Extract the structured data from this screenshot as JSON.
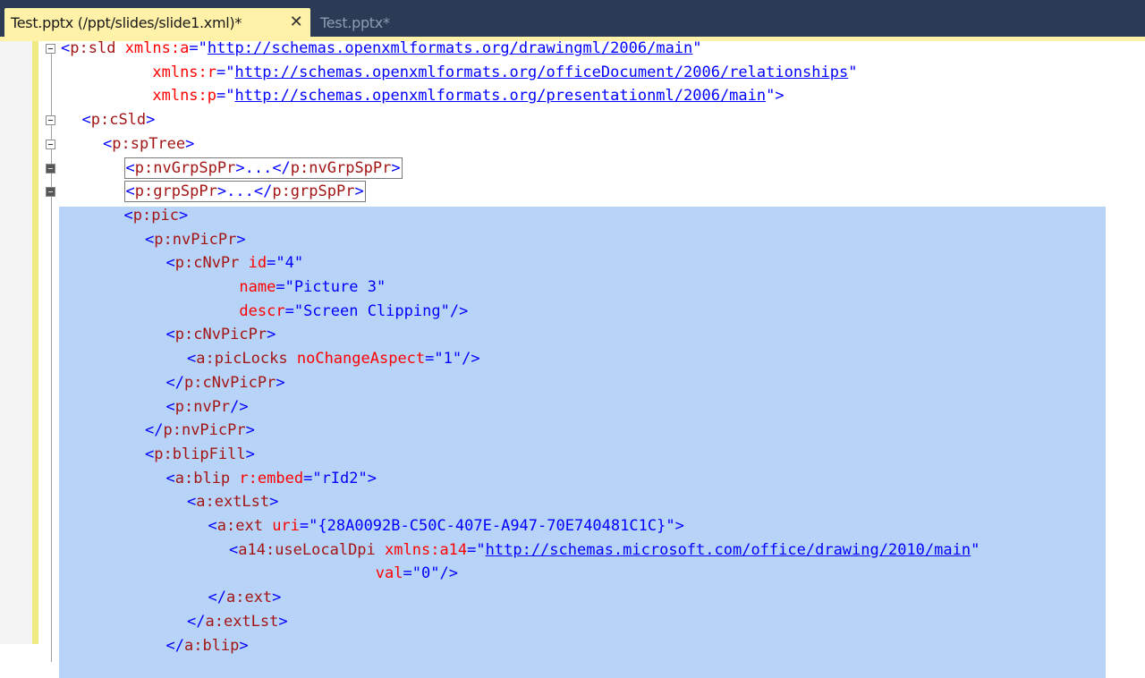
{
  "tabs": [
    {
      "label": "Test.pptx (/ppt/slides/slide1.xml)*",
      "active": true
    },
    {
      "label": "Test.pptx*",
      "active": false
    }
  ],
  "close_glyph": "✕",
  "collapsed_text": "...",
  "lines": [
    {
      "indent": 0,
      "parts": [
        [
          "sym",
          "<"
        ],
        [
          "tag",
          "p:sld"
        ],
        [
          "sym",
          " "
        ],
        [
          "attr",
          "xmlns:a"
        ],
        [
          "sym",
          "=\""
        ],
        [
          "link",
          "http://schemas.openxmlformats.org/drawingml/2006/main"
        ],
        [
          "sym",
          "\""
        ]
      ]
    },
    {
      "indent": 0,
      "parts": [
        [
          "sym",
          "          "
        ],
        [
          "attr",
          "xmlns:r"
        ],
        [
          "sym",
          "=\""
        ],
        [
          "link",
          "http://schemas.openxmlformats.org/officeDocument/2006/relationships"
        ],
        [
          "sym",
          "\""
        ]
      ]
    },
    {
      "indent": 0,
      "parts": [
        [
          "sym",
          "          "
        ],
        [
          "attr",
          "xmlns:p"
        ],
        [
          "sym",
          "=\""
        ],
        [
          "link",
          "http://schemas.openxmlformats.org/presentationml/2006/main"
        ],
        [
          "sym",
          "\">"
        ]
      ]
    },
    {
      "indent": 1,
      "parts": [
        [
          "sym",
          "<"
        ],
        [
          "tag",
          "p:cSld"
        ],
        [
          "sym",
          ">"
        ]
      ]
    },
    {
      "indent": 2,
      "parts": [
        [
          "sym",
          "<"
        ],
        [
          "tag",
          "p:spTree"
        ],
        [
          "sym",
          ">"
        ]
      ]
    },
    {
      "indent": 3,
      "collapsed": true,
      "parts": [
        [
          "sym",
          "<"
        ],
        [
          "tag",
          "p:nvGrpSpPr"
        ],
        [
          "sym",
          ">"
        ],
        [
          "col",
          ""
        ],
        [
          "sym",
          "</"
        ],
        [
          "tag",
          "p:nvGrpSpPr"
        ],
        [
          "sym",
          ">"
        ]
      ]
    },
    {
      "indent": 3,
      "collapsed": true,
      "parts": [
        [
          "sym",
          "<"
        ],
        [
          "tag",
          "p:grpSpPr"
        ],
        [
          "sym",
          ">"
        ],
        [
          "col",
          ""
        ],
        [
          "sym",
          "</"
        ],
        [
          "tag",
          "p:grpSpPr"
        ],
        [
          "sym",
          ">"
        ]
      ]
    },
    {
      "indent": 3,
      "sel": true,
      "parts": [
        [
          "sym",
          "<"
        ],
        [
          "tag",
          "p:pic"
        ],
        [
          "sym",
          ">"
        ]
      ]
    },
    {
      "indent": 4,
      "sel": true,
      "parts": [
        [
          "sym",
          "<"
        ],
        [
          "tag",
          "p:nvPicPr"
        ],
        [
          "sym",
          ">"
        ]
      ]
    },
    {
      "indent": 5,
      "sel": true,
      "parts": [
        [
          "sym",
          "<"
        ],
        [
          "tag",
          "p:cNvPr"
        ],
        [
          "sym",
          " "
        ],
        [
          "attr",
          "id"
        ],
        [
          "sym",
          "=\""
        ],
        [
          "val",
          "4"
        ],
        [
          "sym",
          "\""
        ]
      ]
    },
    {
      "indent": 5,
      "sel": true,
      "parts": [
        [
          "sym",
          "        "
        ],
        [
          "attr",
          "name"
        ],
        [
          "sym",
          "=\""
        ],
        [
          "val",
          "Picture 3"
        ],
        [
          "sym",
          "\""
        ]
      ]
    },
    {
      "indent": 5,
      "sel": true,
      "parts": [
        [
          "sym",
          "        "
        ],
        [
          "attr",
          "descr"
        ],
        [
          "sym",
          "=\""
        ],
        [
          "val",
          "Screen Clipping"
        ],
        [
          "sym",
          "\"/>"
        ]
      ]
    },
    {
      "indent": 5,
      "sel": true,
      "parts": [
        [
          "sym",
          "<"
        ],
        [
          "tag",
          "p:cNvPicPr"
        ],
        [
          "sym",
          ">"
        ]
      ]
    },
    {
      "indent": 6,
      "sel": true,
      "parts": [
        [
          "sym",
          "<"
        ],
        [
          "tag",
          "a:picLocks"
        ],
        [
          "sym",
          " "
        ],
        [
          "attr",
          "noChangeAspect"
        ],
        [
          "sym",
          "=\""
        ],
        [
          "val",
          "1"
        ],
        [
          "sym",
          "\"/>"
        ]
      ]
    },
    {
      "indent": 5,
      "sel": true,
      "parts": [
        [
          "sym",
          "</"
        ],
        [
          "tag",
          "p:cNvPicPr"
        ],
        [
          "sym",
          ">"
        ]
      ]
    },
    {
      "indent": 5,
      "sel": true,
      "parts": [
        [
          "sym",
          "<"
        ],
        [
          "tag",
          "p:nvPr"
        ],
        [
          "sym",
          "/>"
        ]
      ]
    },
    {
      "indent": 4,
      "sel": true,
      "parts": [
        [
          "sym",
          "</"
        ],
        [
          "tag",
          "p:nvPicPr"
        ],
        [
          "sym",
          ">"
        ]
      ]
    },
    {
      "indent": 4,
      "sel": true,
      "parts": [
        [
          "sym",
          "<"
        ],
        [
          "tag",
          "p:blipFill"
        ],
        [
          "sym",
          ">"
        ]
      ]
    },
    {
      "indent": 5,
      "sel": true,
      "parts": [
        [
          "sym",
          "<"
        ],
        [
          "tag",
          "a:blip"
        ],
        [
          "sym",
          " "
        ],
        [
          "attr",
          "r:embed"
        ],
        [
          "sym",
          "=\""
        ],
        [
          "val",
          "rId2"
        ],
        [
          "sym",
          "\">"
        ]
      ]
    },
    {
      "indent": 6,
      "sel": true,
      "parts": [
        [
          "sym",
          "<"
        ],
        [
          "tag",
          "a:extLst"
        ],
        [
          "sym",
          ">"
        ]
      ]
    },
    {
      "indent": 7,
      "sel": true,
      "parts": [
        [
          "sym",
          "<"
        ],
        [
          "tag",
          "a:ext"
        ],
        [
          "sym",
          " "
        ],
        [
          "attr",
          "uri"
        ],
        [
          "sym",
          "=\""
        ],
        [
          "val",
          "{28A0092B-C50C-407E-A947-70E740481C1C}"
        ],
        [
          "sym",
          "\">"
        ]
      ]
    },
    {
      "indent": 8,
      "sel": true,
      "parts": [
        [
          "sym",
          "<"
        ],
        [
          "tag",
          "a14:useLocalDpi"
        ],
        [
          "sym",
          " "
        ],
        [
          "attr",
          "xmlns:a14"
        ],
        [
          "sym",
          "=\""
        ],
        [
          "link",
          "http://schemas.microsoft.com/office/drawing/2010/main"
        ],
        [
          "sym",
          "\""
        ]
      ]
    },
    {
      "indent": 8,
      "sel": true,
      "parts": [
        [
          "sym",
          "                "
        ],
        [
          "attr",
          "val"
        ],
        [
          "sym",
          "=\""
        ],
        [
          "val",
          "0"
        ],
        [
          "sym",
          "\"/>"
        ]
      ]
    },
    {
      "indent": 7,
      "sel": true,
      "parts": [
        [
          "sym",
          "</"
        ],
        [
          "tag",
          "a:ext"
        ],
        [
          "sym",
          ">"
        ]
      ]
    },
    {
      "indent": 6,
      "sel": true,
      "parts": [
        [
          "sym",
          "</"
        ],
        [
          "tag",
          "a:extLst"
        ],
        [
          "sym",
          ">"
        ]
      ]
    },
    {
      "indent": 5,
      "sel": true,
      "parts": [
        [
          "sym",
          "</"
        ],
        [
          "tag",
          "a:blip"
        ],
        [
          "sym",
          ">"
        ]
      ]
    }
  ],
  "colors": {
    "tab_bar": "#2b3a55",
    "active_tab": "#fff1a8",
    "selection": "#b7d4f8",
    "change_bar": "#f0ea83",
    "tag": "#a31515",
    "attribute": "#ff0000",
    "value": "#0000ff"
  }
}
